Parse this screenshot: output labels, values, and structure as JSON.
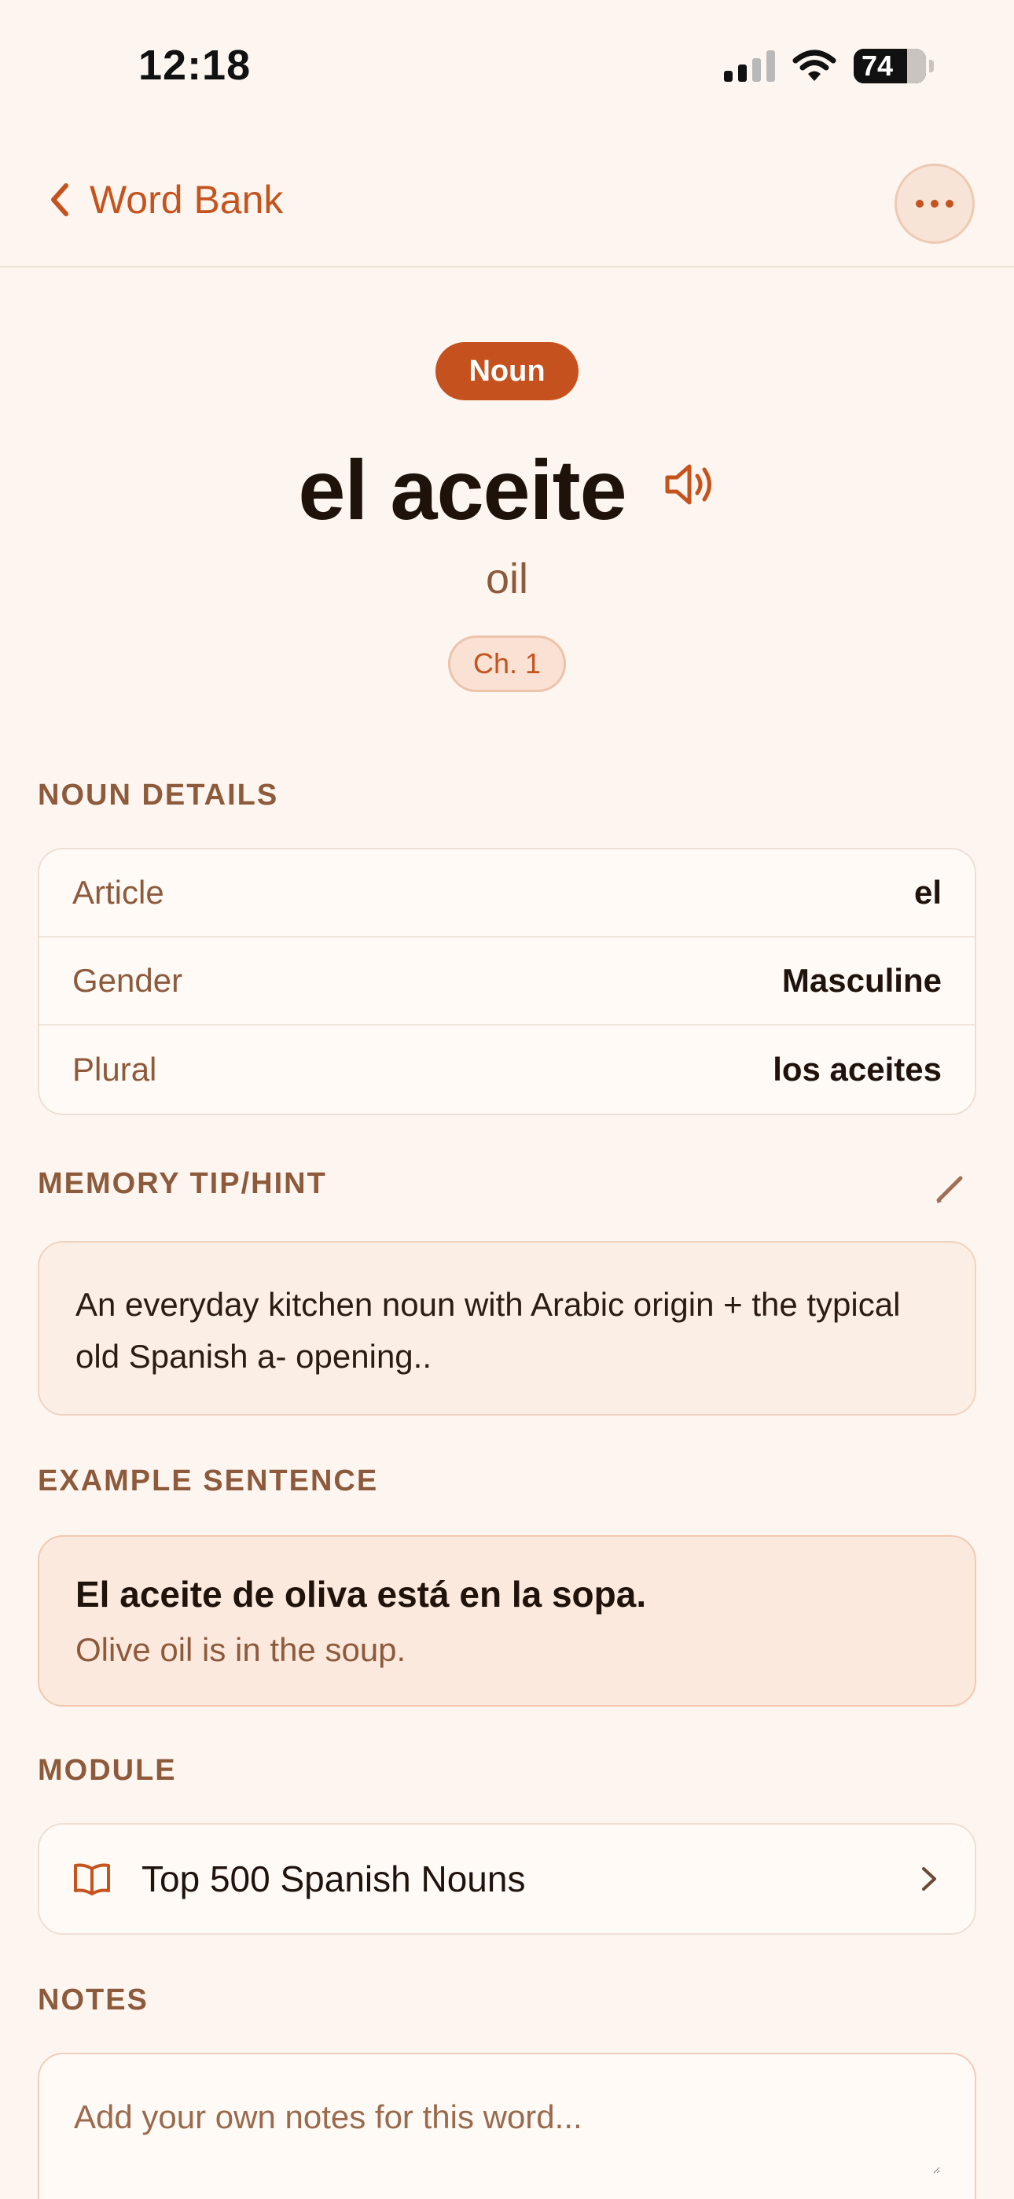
{
  "status_bar": {
    "time": "12:18",
    "battery_level": "74",
    "battery_percent": 74
  },
  "nav": {
    "back_label": "Word Bank",
    "accent_color": "#c5531e"
  },
  "word": {
    "part_of_speech": "Noun",
    "title": "el aceite",
    "translation": "oil",
    "chapter": "Ch. 1"
  },
  "noun_details": {
    "heading": "NOUN DETAILS",
    "rows": [
      {
        "label": "Article",
        "value": "el"
      },
      {
        "label": "Gender",
        "value": "Masculine"
      },
      {
        "label": "Plural",
        "value": "los aceites"
      }
    ]
  },
  "memory_tip": {
    "heading": "MEMORY TIP/HINT",
    "text": "An everyday kitchen noun with Arabic origin + the typical old Spanish a- opening.."
  },
  "example": {
    "heading": "EXAMPLE SENTENCE",
    "spanish": "El aceite de oliva está en la sopa.",
    "english": "Olive oil is in the soup."
  },
  "module": {
    "heading": "MODULE",
    "title": "Top 500 Spanish Nouns"
  },
  "notes": {
    "heading": "NOTES",
    "placeholder": "Add your own notes for this word..."
  }
}
